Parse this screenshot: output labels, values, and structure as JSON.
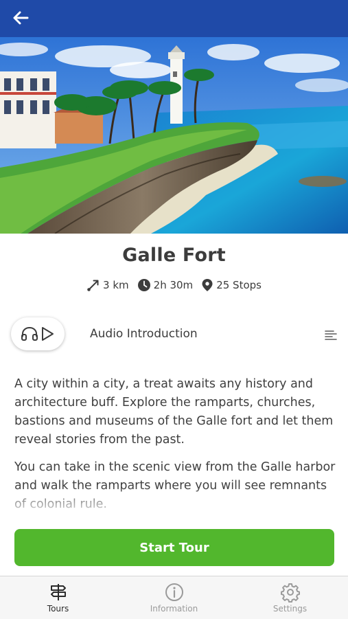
{
  "header": {
    "back_icon": "arrow-left-icon"
  },
  "hero": {
    "image": "galle-fort-lighthouse-ramparts-illustration"
  },
  "tour": {
    "title": "Galle Fort",
    "distance": "3 km",
    "duration": "2h 30m",
    "stops": "25 Stops"
  },
  "audio": {
    "label": "Audio Introduction",
    "icons": [
      "headphones-icon",
      "play-icon"
    ],
    "transcript_icon": "transcript-icon"
  },
  "description": {
    "paragraphs": [
      "A city within a city, a treat awaits any history and architecture buff. Explore the ramparts, churches, bastions and museums of the Galle fort and let them reveal stories from the past.",
      "You can take in the scenic view from the Galle harbor and walk the ramparts where you will see remnants of colonial rule."
    ]
  },
  "actions": {
    "start_label": "Start Tour"
  },
  "nav": {
    "items": [
      {
        "label": "Tours",
        "icon": "signpost-icon",
        "active": true
      },
      {
        "label": "Information",
        "icon": "info-icon",
        "active": false
      },
      {
        "label": "Settings",
        "icon": "gear-icon",
        "active": false
      }
    ]
  },
  "colors": {
    "app_bar": "#1f4aa8",
    "primary_button": "#52b72d",
    "nav_active": "#2a2a2a",
    "nav_inactive": "#9a9a9a"
  }
}
